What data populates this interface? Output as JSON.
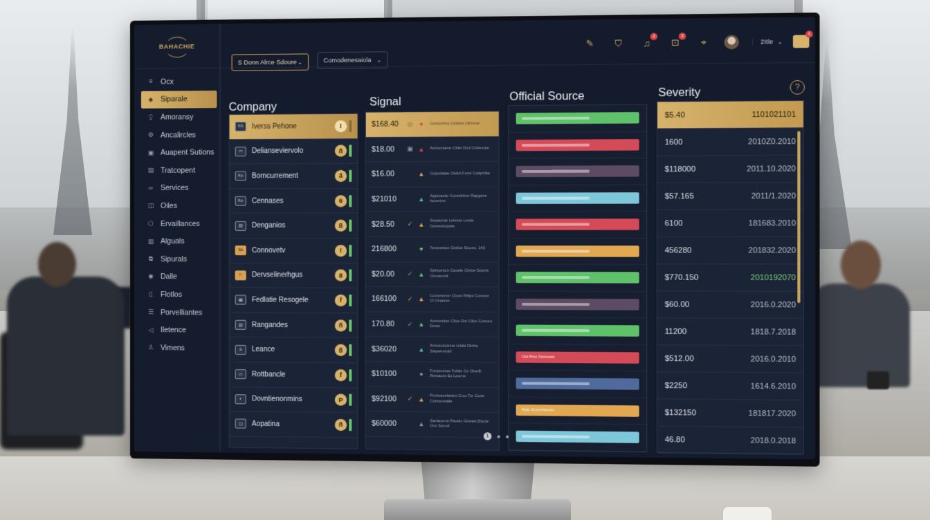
{
  "brand": {
    "name": "BAHACHIE"
  },
  "sidebar": {
    "items": [
      {
        "label": "Ocx",
        "icon": "pin-icon",
        "glyph": "⌾",
        "active": false
      },
      {
        "label": "Siparale",
        "icon": "shield-icon",
        "glyph": "◈",
        "active": true
      },
      {
        "label": "Amoransy",
        "icon": "person-icon",
        "glyph": "⍜",
        "active": false
      },
      {
        "label": "Ancalircles",
        "icon": "gear-icon",
        "glyph": "⚙",
        "active": false
      },
      {
        "label": "Auapent Sutions",
        "icon": "folder-icon",
        "glyph": "▣",
        "active": false
      },
      {
        "label": "Tratcopent",
        "icon": "document-icon",
        "glyph": "▤",
        "active": false
      },
      {
        "label": "Services",
        "icon": "link-icon",
        "glyph": "∞",
        "active": false
      },
      {
        "label": "Oiles",
        "icon": "layers-icon",
        "glyph": "◫",
        "active": false
      },
      {
        "label": "Ervaillances",
        "icon": "badge-icon",
        "glyph": "⬡",
        "active": false
      },
      {
        "label": "Alguals",
        "icon": "bar-chart-icon",
        "glyph": "▥",
        "active": false
      },
      {
        "label": "Sipurals",
        "icon": "copy-icon",
        "glyph": "⧉",
        "active": false
      },
      {
        "label": "Dalle",
        "icon": "network-icon",
        "glyph": "✱",
        "active": false
      },
      {
        "label": "Flotlos",
        "icon": "file-icon",
        "glyph": "▯",
        "active": false
      },
      {
        "label": "Porvelliantes",
        "icon": "list-icon",
        "glyph": "☰",
        "active": false
      },
      {
        "label": "Iletence",
        "icon": "sound-icon",
        "glyph": "◁",
        "active": false
      },
      {
        "label": "Vimens",
        "icon": "person-icon",
        "glyph": "♙",
        "active": false
      }
    ]
  },
  "header": {
    "filter1": "S Donn Alrce Sdoure",
    "filter2": "Comodenesaiola",
    "user_label": "2Itle",
    "badges": {
      "bell": "2",
      "inbox": "2",
      "bag": "1"
    },
    "icons": [
      "edit-icon",
      "tag-icon",
      "bell-icon",
      "inbox-icon",
      "location-icon"
    ]
  },
  "columns": {
    "company": "Company",
    "signal": "Signal",
    "source": "Official Source",
    "severity": "Severity"
  },
  "colors": {
    "accent_gold": "#d6b26b",
    "positive": "#6cc46a",
    "negative": "#d64545",
    "warning": "#e6a24a",
    "info": "#5ab3cf"
  },
  "company_rows": [
    {
      "name": "Iverss Pehone",
      "icon_text": "SS",
      "gold_icon": false,
      "coin": "!",
      "highlight": true
    },
    {
      "name": "Delianseviervolo",
      "icon_text": "▭",
      "gold_icon": false,
      "coin": "ñ",
      "highlight": false
    },
    {
      "name": "Borncurrement",
      "icon_text": "Ko",
      "gold_icon": false,
      "coin": "â",
      "highlight": false
    },
    {
      "name": "Cennases",
      "icon_text": "Ko",
      "gold_icon": false,
      "coin": "6",
      "highlight": false
    },
    {
      "name": "Denganios",
      "icon_text": "▥",
      "gold_icon": false,
      "coin": "ß",
      "highlight": false
    },
    {
      "name": "Connovetv",
      "icon_text": "Sk",
      "gold_icon": true,
      "coin": "!",
      "highlight": false
    },
    {
      "name": "Dervselinerhgus",
      "icon_text": "⚐",
      "gold_icon": true,
      "coin": "8",
      "highlight": false
    },
    {
      "name": "Fedlatie Resogele",
      "icon_text": "▦",
      "gold_icon": false,
      "coin": "f",
      "highlight": false
    },
    {
      "name": "Rangandes",
      "icon_text": "▥",
      "gold_icon": false,
      "coin": "ñ",
      "highlight": false
    },
    {
      "name": "Leance",
      "icon_text": "♙",
      "gold_icon": false,
      "coin": "ß",
      "highlight": false
    },
    {
      "name": "Rottbancle",
      "icon_text": "▭",
      "gold_icon": false,
      "coin": "f",
      "highlight": false
    },
    {
      "name": "Dovntienonmins",
      "icon_text": "◐",
      "gold_icon": false,
      "coin": "P",
      "highlight": false
    },
    {
      "name": "Aopatina",
      "icon_text": "◫",
      "gold_icon": false,
      "coin": "ñ",
      "highlight": false
    }
  ],
  "signal_rows": [
    {
      "value": "$168.40",
      "mark": "◎",
      "mark_color": "#8a6f3a",
      "tri": "●",
      "tri_color": "#d64545",
      "text": "Cursovrmo Ciclelrs Cilinrme",
      "highlight": true
    },
    {
      "value": "$18.00",
      "mark": "▣",
      "mark_color": "#8c94a6",
      "tri": "▲",
      "tri_color": "#d64545",
      "text": "Aeriocraene Cirlet Dod Cotteorpe",
      "highlight": false
    },
    {
      "value": "$16.00",
      "mark": "",
      "mark_color": "#8c94a6",
      "tri": "▲",
      "tri_color": "#e6a24a",
      "text": "Copudatae Ciebri Fornt Cottprtitte",
      "highlight": false
    },
    {
      "value": "$21010",
      "mark": "",
      "mark_color": "#8c94a6",
      "tri": "▲",
      "tri_color": "#5ab3cf",
      "text": "Apptoaciie Conedrtme Rapgane Isoeerne",
      "highlight": false
    },
    {
      "value": "$28.50",
      "mark": "✓",
      "mark_color": "#e6a24a",
      "tri": "▲",
      "tri_color": "#e6a24a",
      "text": "Sepactnte Letnrse Lerde Cerestiocpote",
      "highlight": false
    },
    {
      "value": "216800",
      "mark": "",
      "mark_color": "#8c94a6",
      "tri": "♥",
      "tri_color": "#6cc46a",
      "text": "Terecreticn Ciniloe Sicoes, 140",
      "highlight": false
    },
    {
      "value": "$20.00",
      "mark": "✓",
      "mark_color": "#6cc46a",
      "tri": "▲",
      "tri_color": "#6cc46a",
      "text": "Spinuertcn Caoate Cinloe Scieris Cinoserott",
      "highlight": false
    },
    {
      "value": "166100",
      "mark": "✓",
      "mark_color": "#e6a24a",
      "tri": "▲",
      "tri_color": "#e6a24a",
      "text": "Conoreercn Ctcoe Rtlipe Comeer Cl Cinanee",
      "highlight": false
    },
    {
      "value": "170.80",
      "mark": "✓",
      "mark_color": "#6cc46a",
      "tri": "▲",
      "tri_color": "#6cc46a",
      "text": "Aurecretne Ciloe Dot Cilce Conseo Dowe",
      "highlight": false
    },
    {
      "value": "$36020",
      "mark": "",
      "mark_color": "#8c94a6",
      "tri": "▲",
      "tri_color": "#5ab3cf",
      "text": "Annocotcsnne Iolala Dinfra Sisperrerobl",
      "highlight": false
    },
    {
      "value": "$10100",
      "mark": "",
      "mark_color": "#8c94a6",
      "tri": "●",
      "tri_color": "#8c94a6",
      "text": "Fonprocvss Feiilte Ce Oineflt Reisacxe Eo Leome",
      "highlight": false
    },
    {
      "value": "$92100",
      "mark": "✓",
      "mark_color": "#e6a24a",
      "tri": "▲",
      "tri_color": "#e6a24a",
      "text": "Pontoacelasies Croo Tor Corte Ccinnereatle",
      "highlight": false
    },
    {
      "value": "$60000",
      "mark": "",
      "mark_color": "#8c94a6",
      "tri": "▲",
      "tri_color": "#8c94a6",
      "text": "Sanaceme Pacelo Gtnstet Disole Oxs Secod",
      "highlight": false
    }
  ],
  "source_rows": [
    {
      "color": "#5fc16a",
      "text": ""
    },
    {
      "color": "#d44b57",
      "text": ""
    },
    {
      "color": "#5d4a63",
      "text": ""
    },
    {
      "color": "#7ec6d9",
      "text": ""
    },
    {
      "color": "#d44b57",
      "text": ""
    },
    {
      "color": "#e1a751",
      "text": ""
    },
    {
      "color": "#5fc16a",
      "text": ""
    },
    {
      "color": "#5d4a63",
      "text": ""
    },
    {
      "color": "#5fc16a",
      "text": ""
    },
    {
      "color": "#d44b57",
      "text": "Otd Pivn Sruronce"
    },
    {
      "color": "#4f6a9c",
      "text": ""
    },
    {
      "color": "#e1a751",
      "text": "Mdd Sruriinfacsse"
    },
    {
      "color": "#7ec6d9",
      "text": ""
    }
  ],
  "severity_rows": [
    {
      "value": "$5.40",
      "date": "1101021101",
      "highlight": true,
      "green": false
    },
    {
      "value": "1600",
      "date": "2010Z0.2010",
      "highlight": false,
      "green": false
    },
    {
      "value": "$118000",
      "date": "2011.10.2020",
      "highlight": false,
      "green": false
    },
    {
      "value": "$57.165",
      "date": "2011/1.2020",
      "highlight": false,
      "green": false
    },
    {
      "value": "6100",
      "date": "181683.2010",
      "highlight": false,
      "green": false
    },
    {
      "value": "456280",
      "date": "201832.2020",
      "highlight": false,
      "green": false
    },
    {
      "value": "$770.150",
      "date": "2010192070",
      "highlight": false,
      "green": true
    },
    {
      "value": "$60.00",
      "date": "2016.0.2020",
      "highlight": false,
      "green": false
    },
    {
      "value": "11200",
      "date": "1818.7.2018",
      "highlight": false,
      "green": false
    },
    {
      "value": "$512.00",
      "date": "2016.0.2010",
      "highlight": false,
      "green": false
    },
    {
      "value": "$2250",
      "date": "1614.6.2010",
      "highlight": false,
      "green": false
    },
    {
      "value": "$132150",
      "date": "181817.2020",
      "highlight": false,
      "green": false
    },
    {
      "value": "46.80",
      "date": "2018.0.2018",
      "highlight": false,
      "green": false
    }
  ],
  "pager": {
    "current": "1"
  }
}
